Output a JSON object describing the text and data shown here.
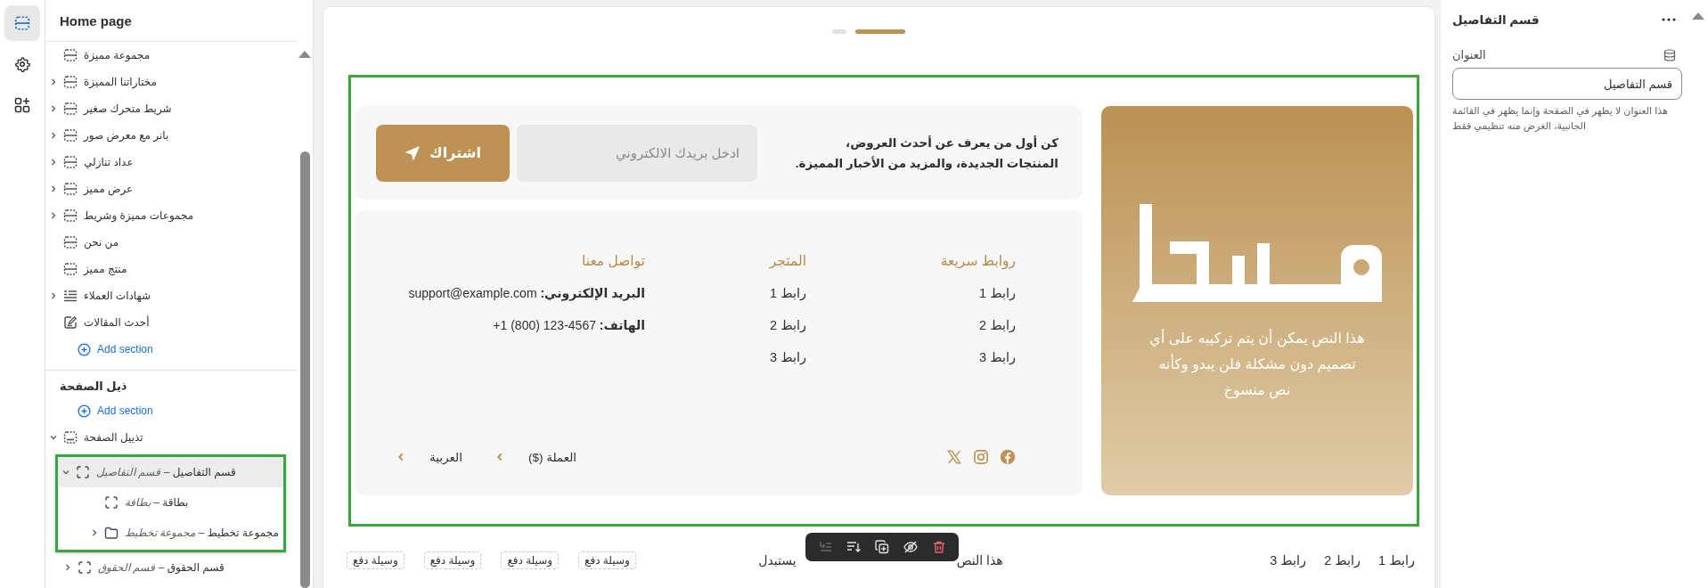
{
  "rail": [
    {
      "kind": "sections",
      "selected": true
    },
    {
      "kind": "settings",
      "selected": false
    },
    {
      "kind": "apps",
      "selected": false
    }
  ],
  "sidebar": {
    "title": "Home page",
    "groups": [
      {
        "rows": [
          {
            "kind": "section",
            "label": "مجموعة مميزة",
            "selected": false,
            "highlighted": false
          },
          {
            "kind": "section",
            "label": "مختاراتنا المميزة",
            "expanded": false,
            "selected": false,
            "highlighted": false
          },
          {
            "kind": "section",
            "label": "شريط متحرك صغير",
            "expanded": false,
            "selected": false,
            "highlighted": false
          },
          {
            "kind": "section",
            "label": "بانر مع معرض صور",
            "expanded": false,
            "selected": false,
            "highlighted": false
          },
          {
            "kind": "section",
            "label": "عداد تنازلي",
            "expanded": false,
            "selected": false,
            "highlighted": false
          },
          {
            "kind": "section",
            "label": "عرض مميز",
            "expanded": false,
            "selected": false,
            "highlighted": false
          },
          {
            "kind": "section",
            "label": "مجموعات مميزة وشريط",
            "expanded": false,
            "selected": false,
            "highlighted": false
          },
          {
            "kind": "section",
            "label": "من نحن",
            "selected": false,
            "highlighted": false
          },
          {
            "kind": "section",
            "label": "منتج مميز",
            "selected": false,
            "highlighted": false
          },
          {
            "kind": "testimonials",
            "label": "شهادات العملاء",
            "expanded": false,
            "selected": false,
            "highlighted": false
          },
          {
            "kind": "blog",
            "label": "أحدث المقالات",
            "selected": false,
            "highlighted": false
          },
          {
            "kind": "add",
            "label": "Add section"
          }
        ]
      },
      {
        "heading": "ذيل الصفحة",
        "rows": [
          {
            "kind": "add",
            "label": "Add section"
          },
          {
            "kind": "footer",
            "label": "تذييل الصفحة",
            "expanded": true,
            "selected": false,
            "highlighted": false,
            "children": [
              {
                "kind": "block",
                "label": "قسم التفاصيل",
                "type": "– قسم التفاصيل",
                "expanded": true,
                "selected": true,
                "highlighted": true,
                "children": [
                  {
                    "kind": "block",
                    "label": "بطاقة",
                    "type": "– بطاقة",
                    "selected": false,
                    "highlighted": false
                  },
                  {
                    "kind": "folder",
                    "label": "مجموعة تخطيط",
                    "type": "– مجموعة تخطيط",
                    "expanded": false,
                    "selected": false,
                    "highlighted": false
                  }
                ]
              },
              {
                "kind": "block",
                "label": "قسم الحقوق",
                "type": "– قسم الحقوق",
                "expanded": false,
                "selected": false,
                "highlighted": false
              }
            ]
          }
        ]
      }
    ]
  },
  "preview": {
    "slides": [
      {
        "selected": false
      },
      {
        "selected": true
      }
    ],
    "highlighted": true,
    "newsletter": {
      "text": "كن أول من يعرف عن أحدث العروض،\nالمنتجات الجديدة، والمزيد من الأخبار المميزة.",
      "placeholder": "ادخل بريدك الالكتروني",
      "button": "اشتراك"
    },
    "columns": [
      {
        "kind": "links",
        "heading": "روابط سريعة",
        "items": [
          "رابط 1",
          "رابط 2",
          "رابط 3"
        ]
      },
      {
        "kind": "links",
        "heading": "المتجر",
        "items": [
          "رابط 1",
          "رابط 2",
          "رابط 3"
        ]
      },
      {
        "kind": "contact",
        "heading": "تواصل معنا",
        "items": [
          {
            "label": "البريد الإلكتروني:",
            "value": "support@example.com"
          },
          {
            "label": "الهاتف:",
            "value": "+1 (800) 123-4567"
          }
        ]
      }
    ],
    "selectors": [
      "العملة ($)",
      "العربية"
    ],
    "brand": {
      "text": "هذا النص يمكن أن يتم تركيبه على أي\nتصميم دون مشكلة فلن يبدو وكأنه\nنص منسوخ"
    },
    "bottom": {
      "links": [
        "رابط 1",
        "رابط 2",
        "رابط 3"
      ],
      "text_parts": [
        "هذا النص",
        "يستبدل"
      ],
      "payments": [
        "وسيلة دفع",
        "وسيلة دفع",
        "وسيلة دفع",
        "وسيلة دفع"
      ]
    },
    "toolbar": [
      {
        "kind": "move-out",
        "disabled": true
      },
      {
        "kind": "sort",
        "disabled": false
      },
      {
        "kind": "duplicate",
        "disabled": false
      },
      {
        "kind": "hide",
        "disabled": false
      },
      {
        "kind": "delete",
        "disabled": false
      }
    ]
  },
  "settings": {
    "title": "قسم التفاصيل",
    "field": {
      "label": "العنوان",
      "value": "قسم التفاصيل",
      "help": "هذا العنوان لا يظهر في الصفحة وإنما يظهر في القائمة الجانبية، الغرض منه تنظيمي فقط"
    }
  }
}
